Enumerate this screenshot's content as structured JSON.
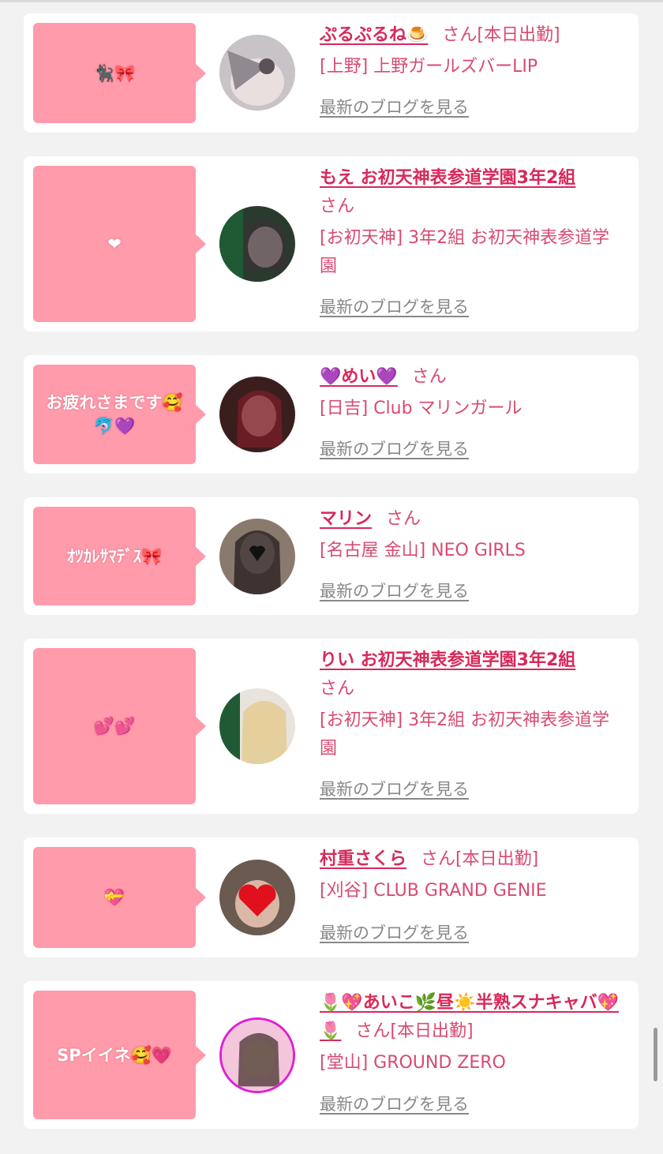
{
  "items": [
    {
      "message": "🐈‍⬛🎀",
      "name": "ぷるぷるね🍮",
      "san": "さん",
      "badge": "[本日出勤]",
      "shop": "[上野] 上野ガールズバーLIP",
      "blog_link": "最新のブログを見る"
    },
    {
      "message": "❤",
      "name": "もえ お初天神表参道学園3年2組",
      "san": "さん",
      "badge": "",
      "shop": "[お初天神] 3年2組 お初天神表参道学園",
      "blog_link": "最新のブログを見る"
    },
    {
      "message": "お疲れさまです🥰🐬💜",
      "name": "💜めい💜",
      "san": "さん",
      "badge": "",
      "shop": "[日吉] Club マリンガール",
      "blog_link": "最新のブログを見る"
    },
    {
      "message": "ｵﾂｶﾚｻﾏﾃﾞｽ🎀",
      "name": "マリン",
      "san": "さん",
      "badge": "",
      "shop": "[名古屋 金山] NEO GIRLS",
      "blog_link": "最新のブログを見る"
    },
    {
      "message": "💕💕",
      "name": "りい お初天神表参道学園3年2組",
      "san": "さん",
      "badge": "",
      "shop": "[お初天神] 3年2組 お初天神表参道学園",
      "blog_link": "最新のブログを見る"
    },
    {
      "message": "💝",
      "name": "村重さくら",
      "san": "さん",
      "badge": "[本日出勤]",
      "shop": "[刈谷] CLUB GRAND GENIE",
      "blog_link": "最新のブログを見る"
    },
    {
      "message": "SPイイネ🥰💗",
      "name": "🌷💖あいこ🌿昼☀️半熟スナキャバ💖🌷",
      "san": "さん",
      "badge": "[本日出勤]",
      "shop": "[堂山] GROUND ZERO",
      "blog_link": "最新のブログを見る"
    }
  ],
  "colors": {
    "bubble": "#ff9bab",
    "name": "#d9285a",
    "text": "#d94a70",
    "link": "#888888",
    "background": "#f2f2f2"
  }
}
